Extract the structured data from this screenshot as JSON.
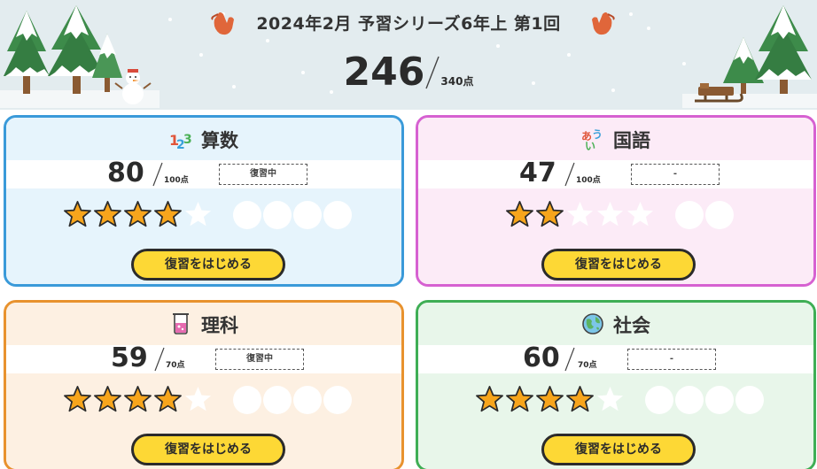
{
  "header": {
    "title": "2024年2月 予習シリーズ6年上 第1回",
    "total_score": "246",
    "total_max": "340点"
  },
  "colors": {
    "math": "#3a9ad9",
    "japanese": "#d661d1",
    "science": "#e8922e",
    "social": "#3fae55",
    "button": "#fdd835",
    "star": "#f7a51c"
  },
  "subjects": [
    {
      "name": "算数",
      "icon": "numbers-icon",
      "score": "80",
      "max": "100点",
      "status": "復習中",
      "stars": 4,
      "star_total": 5,
      "circles": 4,
      "button": "復習をはじめる"
    },
    {
      "name": "国語",
      "icon": "hiragana-icon",
      "score": "47",
      "max": "100点",
      "status": "-",
      "stars": 2,
      "star_total": 5,
      "circles": 2,
      "button": "復習をはじめる"
    },
    {
      "name": "理科",
      "icon": "beaker-icon",
      "score": "59",
      "max": "70点",
      "status": "復習中",
      "stars": 4,
      "star_total": 5,
      "circles": 4,
      "button": "復習をはじめる"
    },
    {
      "name": "社会",
      "icon": "globe-icon",
      "score": "60",
      "max": "70点",
      "status": "-",
      "stars": 4,
      "star_total": 5,
      "circles": 4,
      "button": "復習をはじめる"
    }
  ]
}
